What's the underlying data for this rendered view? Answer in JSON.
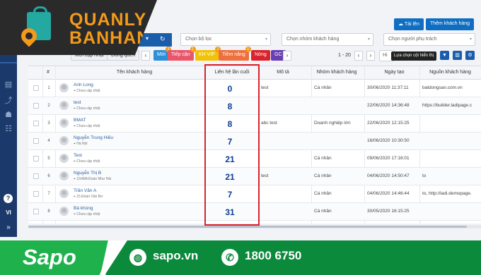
{
  "logo": {
    "line1": "QUANLY",
    "line2": "BANHANG"
  },
  "topbar": {
    "filter_select": "Chọn bộ lọc",
    "group_select": "Chọn nhóm khách hàng",
    "owner_select": "Chọn người phụ trách",
    "upload_label": "Tải lên",
    "add_customer_label": "Thêm khách hàng"
  },
  "tabs": [
    {
      "label": "Mới cập nhật",
      "badge": "",
      "color": "#7b8794"
    },
    {
      "label": "Đúng quên",
      "badge": "",
      "color": "#7b8794"
    },
    {
      "label": "Mới",
      "badge": "3",
      "color": "#2d8fd6"
    },
    {
      "label": "Tiếp cận",
      "badge": "1",
      "color": "#e9566a"
    },
    {
      "label": "KH VIP",
      "badge": "1",
      "color": "#f2c20b"
    },
    {
      "label": "Tiềm năng",
      "badge": "1",
      "color": "#ef6f3d"
    },
    {
      "label": "Nóng",
      "badge": "",
      "color": "#d9232d"
    },
    {
      "label": "GC",
      "badge": "",
      "color": "#6a3fb5"
    }
  ],
  "pager": {
    "range": "1 - 20",
    "page_size": "Hi"
  },
  "tooltip": "Lựa chọn cột hiển thị",
  "headers": {
    "index": "#",
    "name": "Tên khách hàng",
    "last_contact": "Liên hệ lần cuối",
    "desc": "Mô tả",
    "group": "Nhóm khách hàng",
    "created": "Ngày tạo",
    "source": "Nguồn khách hàng"
  },
  "rows": [
    {
      "no": "1",
      "name": "Anh Long",
      "address": "Chưa cập nhật",
      "last": "0",
      "desc": "test",
      "group": "Cá nhân",
      "created": "30/06/2020 11:37:11",
      "source": "batdongsan.com.vn"
    },
    {
      "no": "2",
      "name": "test",
      "address": "Chưa cập nhật",
      "last": "8",
      "desc": "",
      "group": "",
      "created": "22/06/2020 14:36:48",
      "source": "https://builder.ladipage.c"
    },
    {
      "no": "3",
      "name": "BMAT",
      "address": "Chưa cập nhật",
      "last": "8",
      "desc": "abc test",
      "group": "Doanh nghiệp lớn",
      "created": "22/06/2020 12:15:25",
      "source": ""
    },
    {
      "no": "4",
      "name": "Nguyễn Trung Hiếu",
      "address": "Hà Nội",
      "last": "7",
      "desc": "",
      "group": "",
      "created": "16/06/2020 10:30:50",
      "source": ""
    },
    {
      "no": "5",
      "name": "Test",
      "address": "Chưa cập nhật",
      "last": "21",
      "desc": "",
      "group": "Cá nhân",
      "created": "09/06/2020 17:16:01",
      "source": ""
    },
    {
      "no": "6",
      "name": "Nguyễn Thị B",
      "address": "15/48A Đoàn Như Hải",
      "last": "21",
      "desc": "test",
      "group": "Cá nhân",
      "created": "04/06/2020 14:50:47",
      "source": "to"
    },
    {
      "no": "7",
      "name": "Trần Văn A",
      "address": "15 Đoàn Văn Bơ",
      "last": "7",
      "desc": "",
      "group": "Cá nhân",
      "created": "04/06/2020 14:46:44",
      "source": "to, http://ladi.demopage."
    },
    {
      "no": "8",
      "name": "Bá khùng",
      "address": "Chưa cập nhật",
      "last": "31",
      "desc": "",
      "group": "Cá nhân",
      "created": "30/05/2020 16:15:25",
      "source": ""
    }
  ],
  "sidebar": {
    "help": "?",
    "lang": "VI",
    "expand": "»"
  },
  "footer": {
    "brand": "Sapo",
    "website": "sapo.vn",
    "phone": "1800 6750"
  }
}
